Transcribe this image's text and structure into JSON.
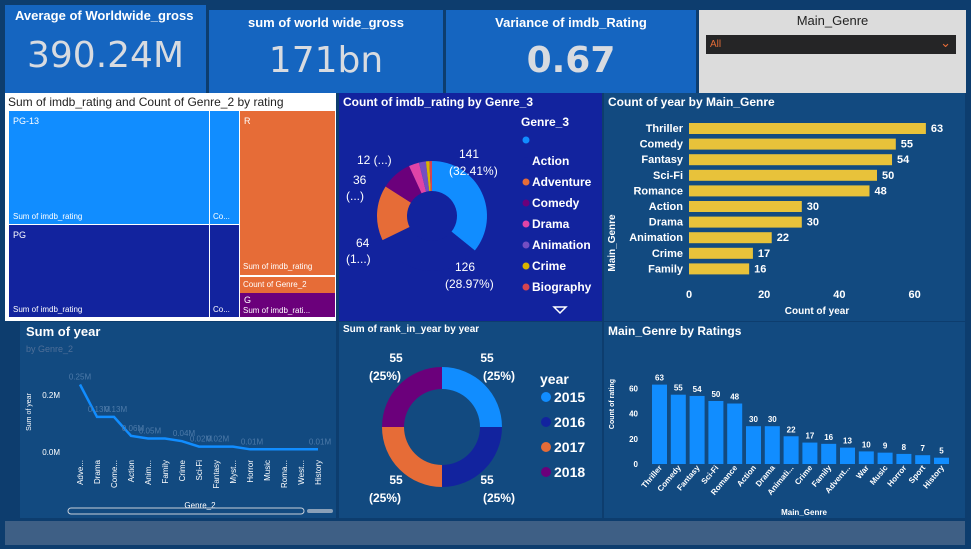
{
  "kpis": [
    {
      "title": "Average of Worldwide_gross",
      "value": "390.24M"
    },
    {
      "title": "sum of world wide_gross",
      "value": "171bn"
    },
    {
      "title": "Variance of imdb_Rating",
      "value": "0.67"
    }
  ],
  "slicer": {
    "title": "Main_Genre",
    "selected": "All"
  },
  "treemap": {
    "title": "Sum of imdb_rating and Count of Genre_2 by rating",
    "cells": [
      {
        "rating": "PG-13",
        "label": "Sum of imdb_rating",
        "sub": "Co...",
        "color": "#118dff"
      },
      {
        "rating": "PG",
        "label": "Sum of imdb_rating",
        "sub": "Co...",
        "color": "#12239e"
      },
      {
        "rating": "R",
        "label": "Sum of imdb_rating",
        "sub": "Count of Genre_2",
        "color": "#e66c37"
      },
      {
        "rating": "G",
        "label": "Sum of imdb_rati...",
        "color": "#6b007b"
      }
    ]
  },
  "donut_genre3": {
    "title": "Count of imdb_rating by Genre_3",
    "legend_title": "Genre_3",
    "legend": [
      {
        "name": "",
        "color": "#118dff"
      },
      {
        "name": "Action",
        "color": "#12239e"
      },
      {
        "name": "Adventure",
        "color": "#e66c37"
      },
      {
        "name": "Comedy",
        "color": "#6b007b"
      },
      {
        "name": "Drama",
        "color": "#e044a7"
      },
      {
        "name": "Animation",
        "color": "#744ec2"
      },
      {
        "name": "Crime",
        "color": "#d9b300"
      },
      {
        "name": "Biography",
        "color": "#d64550"
      }
    ],
    "labels": [
      "141",
      "(32.41%)",
      "126",
      "(28.97%)",
      "64",
      "(1...)",
      "36",
      "(...)",
      "12 (...)"
    ]
  },
  "bar_year": {
    "title": "Count of year by Main_Genre",
    "ylabel": "Main_Genre",
    "xlabel": "Count of year",
    "ticks": [
      "0",
      "20",
      "40",
      "60"
    ]
  },
  "line_year": {
    "title": "Sum of year",
    "subtitle": "by Genre_2",
    "ylabel": "Sum of year",
    "xlabel": "Genre_2",
    "yticks": [
      "0.2M",
      "0.0M"
    ]
  },
  "donut_year": {
    "title": "Sum of rank_in_year by year",
    "legend_title": "year",
    "legend": [
      "2015",
      "2016",
      "2017",
      "2018"
    ],
    "labels": [
      "55",
      "(25%)",
      "55",
      "(25%)",
      "55",
      "(25%)",
      "55",
      "(25%)"
    ]
  },
  "col_ratings": {
    "title": "Main_Genre by Ratings",
    "ylabel": "Count of rating",
    "xlabel": "Main_Genre",
    "yticks": [
      "60",
      "40",
      "20",
      "0"
    ]
  },
  "chart_data": [
    {
      "type": "bar",
      "title": "Count of year by Main_Genre",
      "categories": [
        "Thriller",
        "Comedy",
        "Fantasy",
        "Sci-Fi",
        "Romance",
        "Action",
        "Drama",
        "Animation",
        "Crime",
        "Family"
      ],
      "values": [
        63,
        55,
        54,
        50,
        48,
        30,
        30,
        22,
        17,
        16
      ],
      "xlabel": "Count of year",
      "ylabel": "Main_Genre",
      "xlim": [
        0,
        65
      ],
      "color": "#e8c23a"
    },
    {
      "type": "line",
      "title": "Sum of year",
      "categories": [
        "Adve...",
        "Drama",
        "Come...",
        "Action",
        "Anim...",
        "Family",
        "Crime",
        "Sci-Fi",
        "Fantasy",
        "Myst...",
        "Horror",
        "Music",
        "Roma...",
        "West...",
        "History"
      ],
      "values": [
        0.25,
        0.13,
        0.13,
        0.06,
        0.05,
        0.05,
        0.04,
        0.02,
        0.02,
        0.02,
        0.01,
        0.01,
        0.01,
        0.01,
        0.01
      ],
      "value_labels": [
        "0.25M",
        "0.13M",
        "0.13M",
        "0.06M",
        "0.05M",
        "",
        "0.04M",
        "0.02M",
        "0.02M",
        "",
        "0.01M",
        "",
        "",
        "",
        "0.01M"
      ],
      "ylabel": "Sum of year",
      "xlabel": "Genre_2",
      "ylim": [
        0,
        0.3
      ],
      "color": "#118dff"
    },
    {
      "type": "pie",
      "title": "Sum of rank_in_year by year",
      "categories": [
        "2015",
        "2016",
        "2017",
        "2018"
      ],
      "values": [
        55,
        55,
        55,
        55
      ],
      "colors": [
        "#118dff",
        "#12239e",
        "#e66c37",
        "#6b007b"
      ]
    },
    {
      "type": "pie",
      "title": "Count of imdb_rating by Genre_3",
      "categories": [
        "",
        "Action",
        "Adventure",
        "Comedy",
        "Drama",
        "Animation",
        "Crime",
        "Biography"
      ],
      "values": [
        141,
        126,
        64,
        36,
        12,
        8,
        4,
        3
      ],
      "colors": [
        "#118dff",
        "#12239e",
        "#e66c37",
        "#6b007b",
        "#e044a7",
        "#744ec2",
        "#d9b300",
        "#d64550"
      ]
    },
    {
      "type": "bar",
      "title": "Main_Genre by Ratings",
      "categories": [
        "Thriller",
        "Comedy",
        "Fantasy",
        "Sci-Fi",
        "Romance",
        "Action",
        "Drama",
        "Animati...",
        "Crime",
        "Family",
        "Advent...",
        "War",
        "Music",
        "Horror",
        "Sport",
        "History"
      ],
      "values": [
        63,
        55,
        54,
        50,
        48,
        30,
        30,
        22,
        17,
        16,
        13,
        10,
        9,
        8,
        7,
        5
      ],
      "ylabel": "Count of rating",
      "xlabel": "Main_Genre",
      "ylim": [
        0,
        70
      ],
      "color": "#118dff"
    }
  ]
}
